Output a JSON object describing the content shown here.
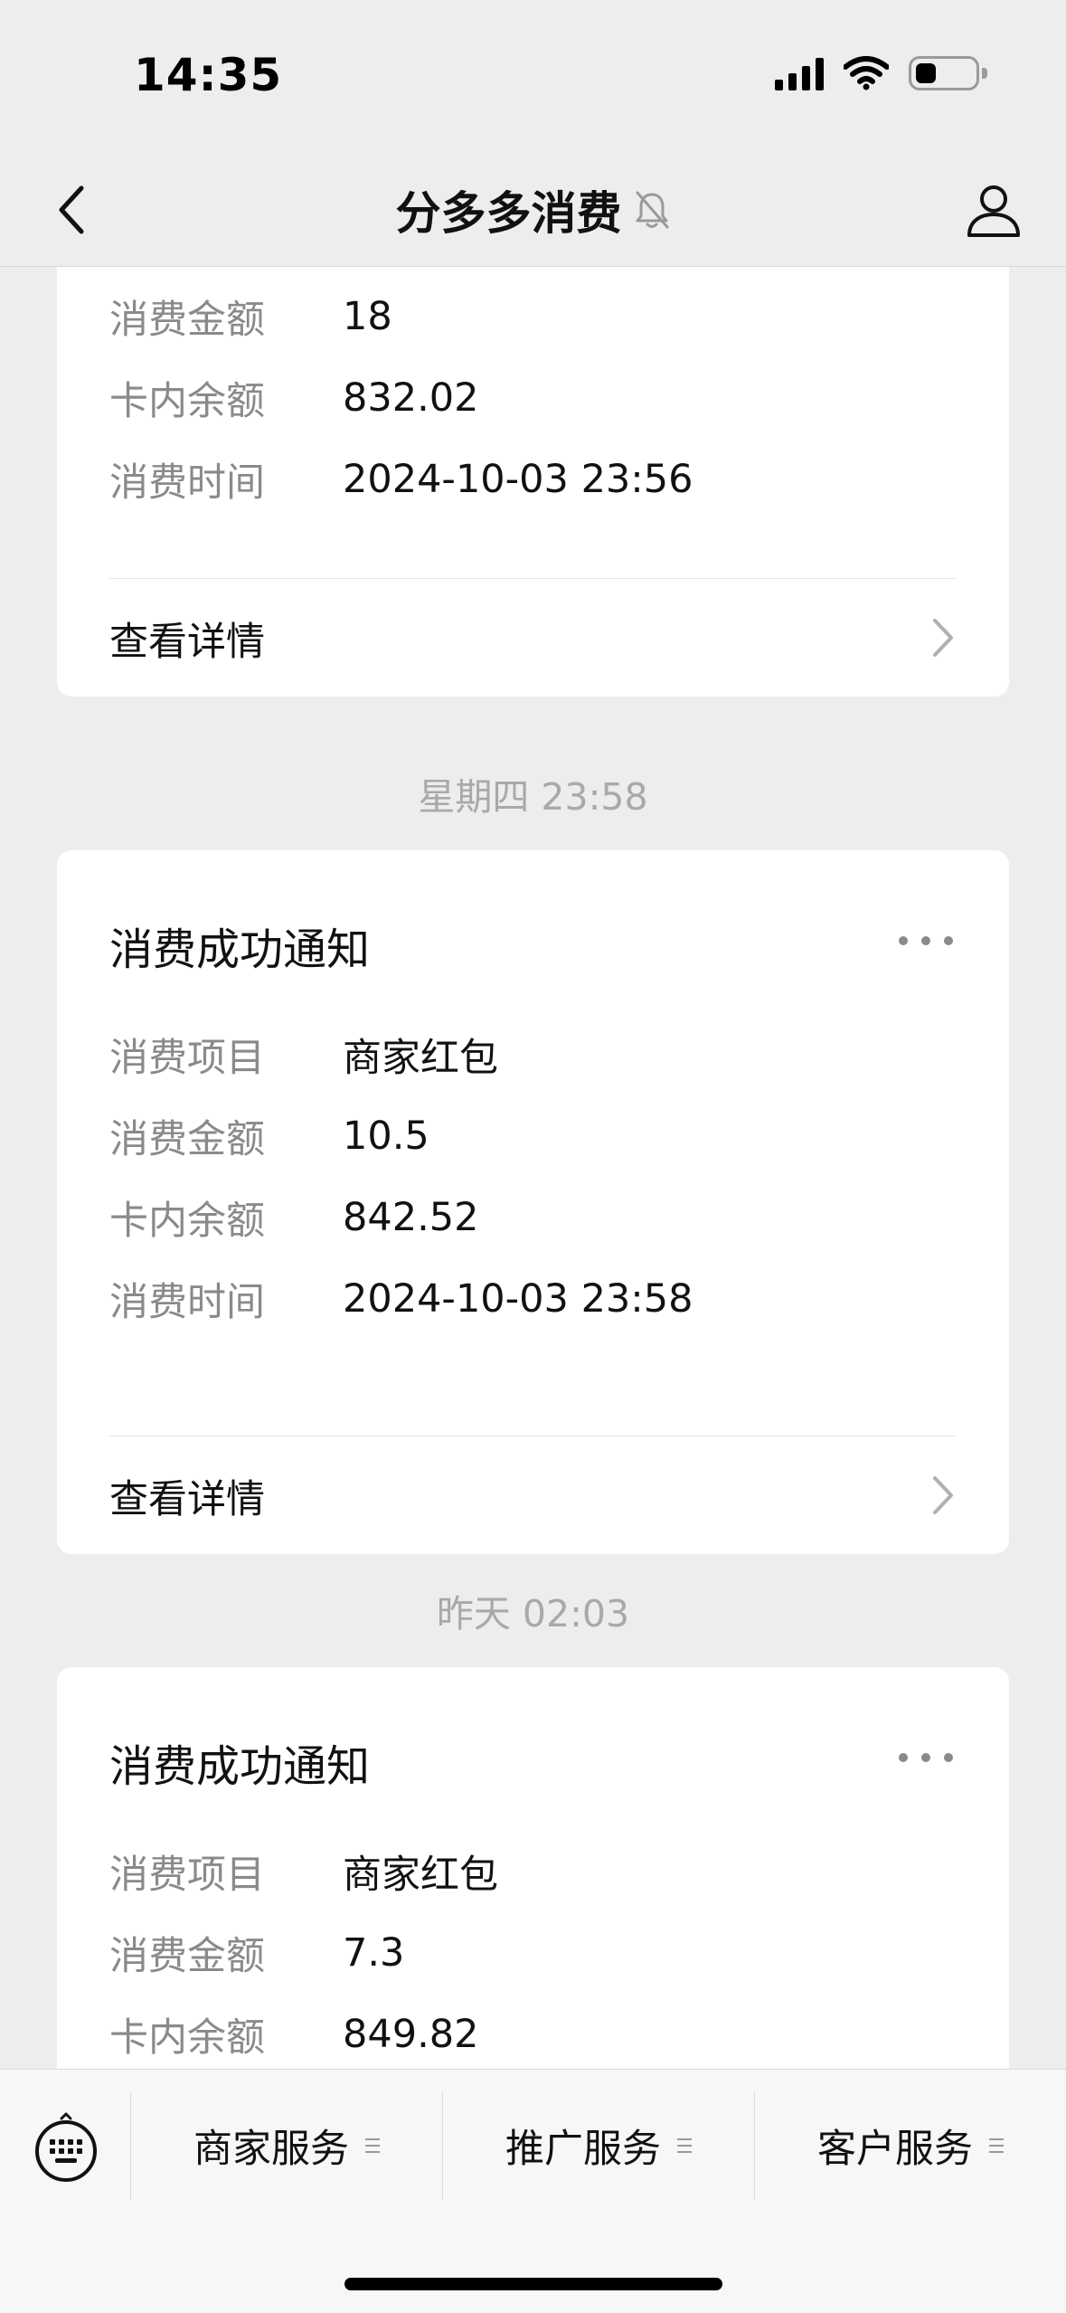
{
  "status_bar": {
    "time": "14:35",
    "battery_level": 0.35
  },
  "header": {
    "title": "分多多消费",
    "muted": true
  },
  "messages": [
    {
      "partial": true,
      "rows": [
        {
          "label": "消费金额",
          "value": "18"
        },
        {
          "label": "卡内余额",
          "value": "832.02"
        },
        {
          "label": "消费时间",
          "value": "2024-10-03 23:56"
        }
      ],
      "detail_label": "查看详情"
    },
    {
      "timestamp": "星期四 23:58",
      "title": "消费成功通知",
      "rows": [
        {
          "label": "消费项目",
          "value": "商家红包"
        },
        {
          "label": "消费金额",
          "value": "10.5"
        },
        {
          "label": "卡内余额",
          "value": "842.52"
        },
        {
          "label": "消费时间",
          "value": "2024-10-03 23:58"
        }
      ],
      "detail_label": "查看详情"
    },
    {
      "timestamp": "昨天 02:03",
      "title": "消费成功通知",
      "rows": [
        {
          "label": "消费项目",
          "value": "商家红包"
        },
        {
          "label": "消费金额",
          "value": "7.3"
        },
        {
          "label": "卡内余额",
          "value": "849.82"
        }
      ]
    }
  ],
  "bottom_menu": {
    "items": [
      {
        "label": "商家服务"
      },
      {
        "label": "推广服务"
      },
      {
        "label": "客户服务"
      }
    ]
  },
  "icons": {
    "back": "chevron-left-icon",
    "profile": "person-icon",
    "mute": "bell-off-icon",
    "more": "ellipsis-icon",
    "detail": "chevron-right-icon",
    "keyboard": "keyboard-icon",
    "menu": "menu-lines-icon"
  }
}
